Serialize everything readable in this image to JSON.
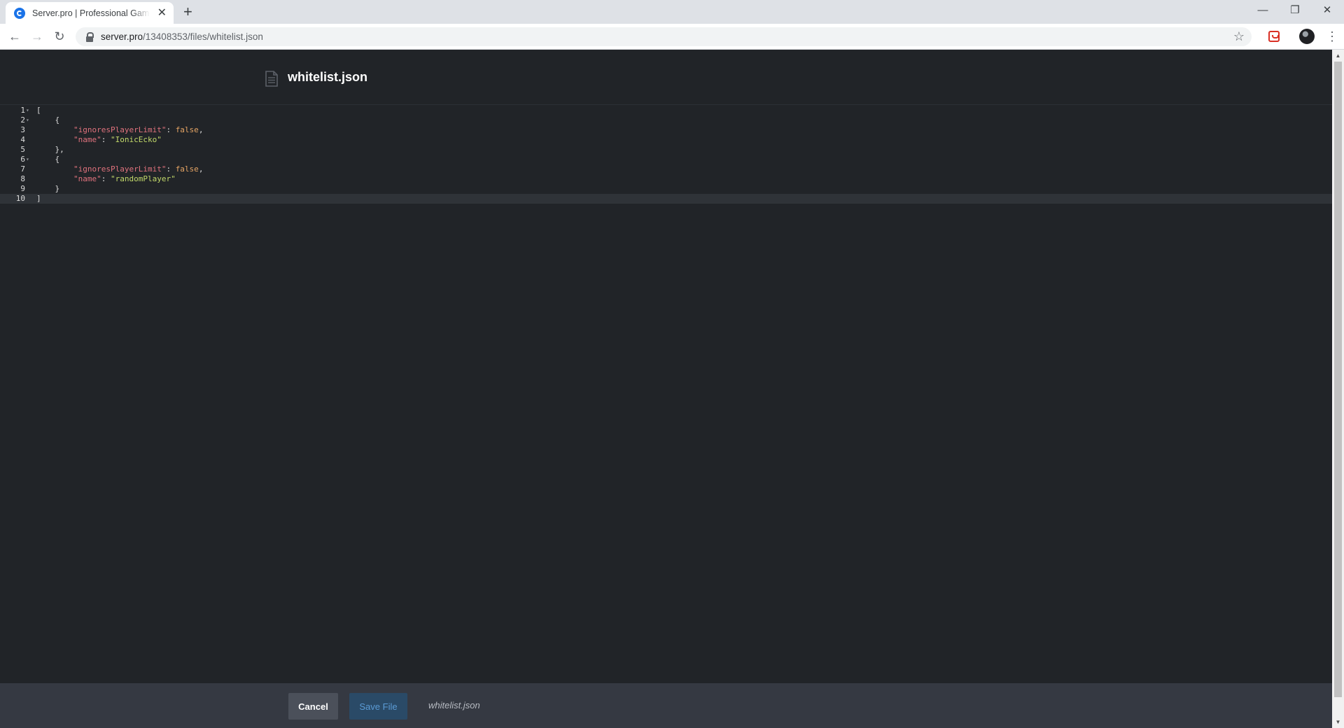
{
  "browser": {
    "tab_title": "Server.pro | Professional Game Server Hosting",
    "tab_close": "✕",
    "new_tab": "+",
    "minimize": "—",
    "restore": "❐",
    "close": "✕",
    "back": "←",
    "forward": "→",
    "reload": "↻",
    "url_host": "server.pro",
    "url_path": "/13408353/files/whitelist.json",
    "bookmark": "☆",
    "menu": "⋮"
  },
  "editor": {
    "file_title": "whitelist.json",
    "lines": [
      {
        "num": "1",
        "fold": true,
        "code": [
          {
            "t": "p",
            "v": "["
          }
        ]
      },
      {
        "num": "2",
        "fold": true,
        "code": [
          {
            "t": "p",
            "v": "    {"
          }
        ]
      },
      {
        "num": "3",
        "fold": false,
        "code": [
          {
            "t": "p",
            "v": "        "
          },
          {
            "t": "k",
            "v": "\"ignoresPlayerLimit\""
          },
          {
            "t": "p",
            "v": ": "
          },
          {
            "t": "b",
            "v": "false"
          },
          {
            "t": "p",
            "v": ","
          }
        ]
      },
      {
        "num": "4",
        "fold": false,
        "code": [
          {
            "t": "p",
            "v": "        "
          },
          {
            "t": "k",
            "v": "\"name\""
          },
          {
            "t": "p",
            "v": ": "
          },
          {
            "t": "s",
            "v": "\"IonicEcko\""
          }
        ]
      },
      {
        "num": "5",
        "fold": false,
        "code": [
          {
            "t": "p",
            "v": "    },"
          }
        ]
      },
      {
        "num": "6",
        "fold": true,
        "code": [
          {
            "t": "p",
            "v": "    {"
          }
        ]
      },
      {
        "num": "7",
        "fold": false,
        "code": [
          {
            "t": "p",
            "v": "        "
          },
          {
            "t": "k",
            "v": "\"ignoresPlayerLimit\""
          },
          {
            "t": "p",
            "v": ": "
          },
          {
            "t": "b",
            "v": "false"
          },
          {
            "t": "p",
            "v": ","
          }
        ]
      },
      {
        "num": "8",
        "fold": false,
        "code": [
          {
            "t": "p",
            "v": "        "
          },
          {
            "t": "k",
            "v": "\"name\""
          },
          {
            "t": "p",
            "v": ": "
          },
          {
            "t": "s",
            "v": "\"randomPlayer\""
          }
        ]
      },
      {
        "num": "9",
        "fold": false,
        "code": [
          {
            "t": "p",
            "v": "    }"
          }
        ]
      },
      {
        "num": "10",
        "fold": false,
        "active": true,
        "code": [
          {
            "t": "p",
            "v": "]"
          }
        ]
      }
    ]
  },
  "footer": {
    "cancel_label": "Cancel",
    "save_label": "Save File",
    "file_name": "whitelist.json"
  },
  "colors": {
    "background": "#212428",
    "footer": "#353942",
    "key": "#e0727d",
    "string": "#c2d96a",
    "boolean": "#e5a464",
    "save_button": "#2a4a67"
  }
}
